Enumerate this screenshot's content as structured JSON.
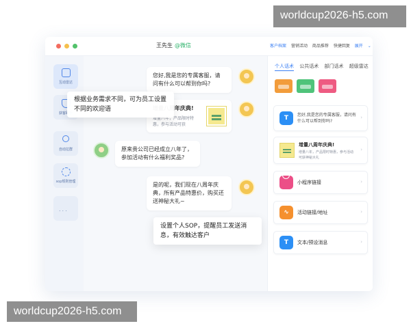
{
  "watermark": {
    "top": "worldcup2026-h5.com",
    "bottom": "worldcup2026-h5.com"
  },
  "titlebar": {
    "contact_name": "王先生",
    "contact_source": "@微信",
    "tabs": [
      "客户档案",
      "营销活动",
      "商品推荐",
      "快捷回复",
      "展开"
    ],
    "expand_icon": "chevron-down-icon"
  },
  "sidebar": {
    "items": [
      {
        "label": "互动雷达",
        "icon": "radar-icon"
      },
      {
        "label": "获客助手",
        "icon": "shield-icon"
      },
      {
        "label": "自动拉群",
        "icon": "user-icon"
      },
      {
        "label": "sop规则管理",
        "icon": "refresh-icon"
      }
    ],
    "more_label": "..."
  },
  "chat": {
    "msg1": "您好,我是您的专属客服，请问有什么可以帮到你吗?",
    "card_title": "增量八周年庆典!",
    "card_sub": "增量八年，产品限时特惠，参与活动可获",
    "msg3": "原来贵公司已经成立八年了，参加活动有什么福利奖品?",
    "msg4": "是的呢，我们现在八周年庆典，所有产品特惠价，购买还送神秘大礼~"
  },
  "callouts": {
    "left": "根据业务需求不同，可为员工设置不同的欢迎语",
    "bottom": "设置个人SOP，提醒员工发送消息，有效触达客户"
  },
  "right_panel": {
    "tabs": [
      "个人话术",
      "公共话术",
      "部门话术",
      "超级雷达"
    ],
    "thumbnails": [
      "orange",
      "green",
      "pink"
    ],
    "cards": [
      {
        "type": "text",
        "text": "您好,我是您的专属客服，请问有什么可以帮到你吗?",
        "icon": "text-icon"
      },
      {
        "type": "poster",
        "title": "增量八周年庆典!",
        "sub": "增量八年，产品限时特惠，参与活动可获神秘大礼",
        "icon": "poster-icon"
      },
      {
        "type": "miniapp",
        "text": "小程序链接",
        "icon": "link-icon"
      },
      {
        "type": "activity",
        "text": "活动链接/地址",
        "icon": "activity-icon"
      },
      {
        "type": "text",
        "text": "文本/预设消息",
        "icon": "text-icon"
      }
    ],
    "arrow_icon": "chevron-right-icon"
  }
}
